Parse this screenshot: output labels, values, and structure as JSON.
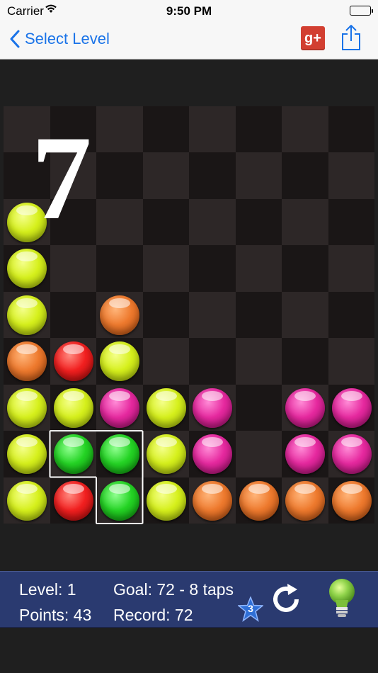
{
  "status_bar": {
    "carrier": "Carrier",
    "time": "9:50 PM"
  },
  "nav": {
    "back_label": "Select Level",
    "google_plus_label": "g+"
  },
  "board": {
    "overlay_number": "7",
    "columns": 8,
    "rows": 9,
    "balls": [
      [
        null,
        null,
        null,
        null,
        null,
        null,
        null,
        null
      ],
      [
        null,
        null,
        null,
        null,
        null,
        null,
        null,
        null
      ],
      [
        "yellow",
        null,
        null,
        null,
        null,
        null,
        null,
        null
      ],
      [
        "yellow",
        null,
        null,
        null,
        null,
        null,
        null,
        null
      ],
      [
        "yellow",
        null,
        "orange",
        null,
        null,
        null,
        null,
        null
      ],
      [
        "orange",
        "red",
        "yellow",
        null,
        null,
        null,
        null,
        null
      ],
      [
        "yellow",
        "yellow",
        "magenta",
        "yellow",
        "magenta",
        null,
        "magenta",
        "magenta"
      ],
      [
        "yellow",
        "green",
        "green",
        "yellow",
        "magenta",
        null,
        "magenta",
        "magenta"
      ],
      [
        "yellow",
        "red",
        "green",
        "yellow",
        "orange",
        "orange",
        "orange",
        "orange"
      ]
    ],
    "selected_cells": [
      [
        7,
        1
      ],
      [
        7,
        2
      ],
      [
        8,
        2
      ]
    ]
  },
  "info": {
    "level": "Level: 1",
    "goal": "Goal: 72 - 8 taps",
    "points": "Points: 43",
    "record": "Record: 72",
    "star_count": "3"
  },
  "icons": {
    "back": "chevron-left-icon",
    "share": "share-icon",
    "refresh": "refresh-icon",
    "hint": "lightbulb-icon",
    "star": "star-icon"
  },
  "colors": {
    "accent": "#1a73e8",
    "info_bar": "#2a3a70",
    "google_plus": "#d23f31"
  }
}
